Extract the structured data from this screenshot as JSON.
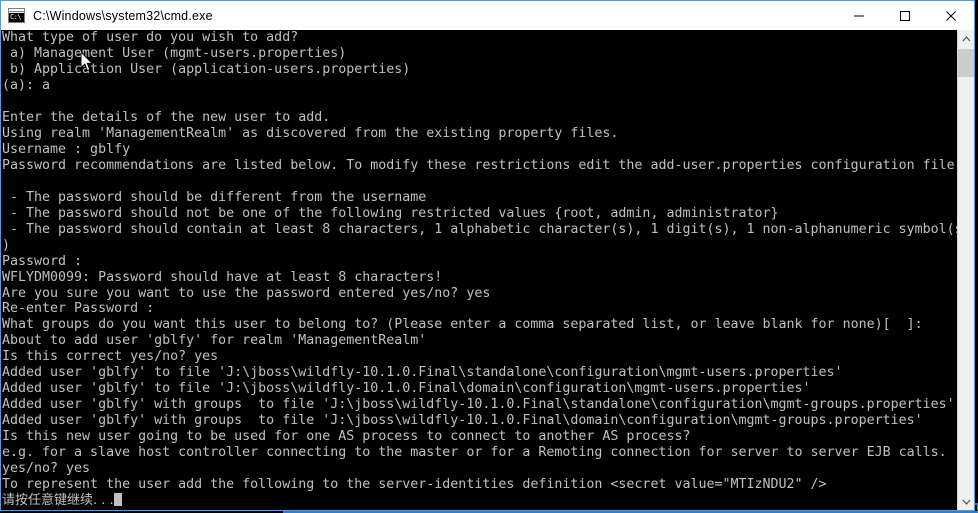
{
  "window": {
    "title": "C:\\Windows\\system32\\cmd.exe",
    "icon_label": "C:\\",
    "icon_name": "cmd-icon",
    "minimize_label": "Minimize",
    "maximize_label": "Maximize",
    "close_label": "Close"
  },
  "colors": {
    "console_background": "#000000",
    "console_foreground": "#c0c0c0",
    "window_border": "#5b9bd5",
    "titlebar_background": "#ffffff",
    "scrollbar_track": "#f0f0f0",
    "scrollbar_thumb": "#cdcdcd",
    "background_window_text": "#19e619",
    "background_window_border": "#2a7fd4"
  },
  "scrollbar": {
    "up_arrow": "▲",
    "down_arrow": "▼",
    "thumb_position": "top"
  },
  "console": {
    "lines": [
      "What type of user do you wish to add?",
      " a) Management User (mgmt-users.properties)",
      " b) Application User (application-users.properties)",
      "(a): a",
      "",
      "Enter the details of the new user to add.",
      "Using realm 'ManagementRealm' as discovered from the existing property files.",
      "Username : gblfy",
      "Password recommendations are listed below. To modify these restrictions edit the add-user.properties configuration file.",
      "",
      " - The password should be different from the username",
      " - The password should not be one of the following restricted values {root, admin, administrator}",
      " - The password should contain at least 8 characters, 1 alphabetic character(s), 1 digit(s), 1 non-alphanumeric symbol(s",
      ")",
      "Password :",
      "WFLYDM0099: Password should have at least 8 characters!",
      "Are you sure you want to use the password entered yes/no? yes",
      "Re-enter Password :",
      "What groups do you want this user to belong to? (Please enter a comma separated list, or leave blank for none)[  ]:",
      "About to add user 'gblfy' for realm 'ManagementRealm'",
      "Is this correct yes/no? yes",
      "Added user 'gblfy' to file 'J:\\jboss\\wildfly-10.1.0.Final\\standalone\\configuration\\mgmt-users.properties'",
      "Added user 'gblfy' to file 'J:\\jboss\\wildfly-10.1.0.Final\\domain\\configuration\\mgmt-users.properties'",
      "Added user 'gblfy' with groups  to file 'J:\\jboss\\wildfly-10.1.0.Final\\standalone\\configuration\\mgmt-groups.properties'",
      "Added user 'gblfy' with groups  to file 'J:\\jboss\\wildfly-10.1.0.Final\\domain\\configuration\\mgmt-groups.properties'",
      "Is this new user going to be used for one AS process to connect to another AS process?",
      "e.g. for a slave host controller connecting to the master or for a Remoting connection for server to server EJB calls.",
      "yes/no? yes",
      "To represent the user add the following to the server-identities definition <secret value=\"MTIzNDU2\" />"
    ],
    "prompt_line": "请按任意键继续. . .",
    "secret_value": "MTIzNDU2",
    "username": "gblfy",
    "realm": "ManagementRealm"
  },
  "background_window": {
    "text": "- The password should not be one of the following restricted values {root, admin, administrator}"
  }
}
